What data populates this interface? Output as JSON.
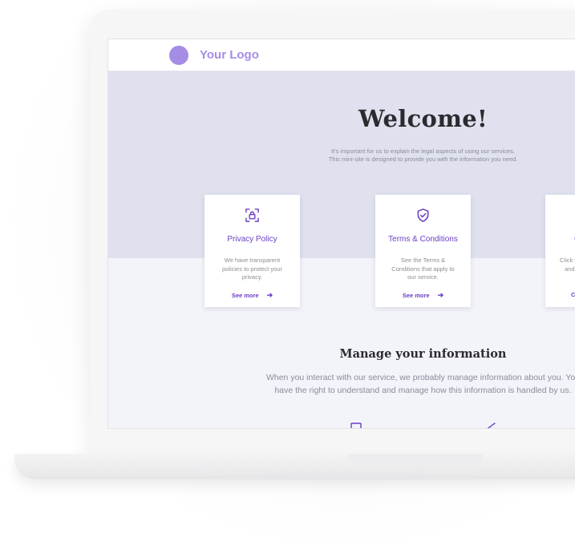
{
  "header": {
    "logo_text": "Your Logo"
  },
  "hero": {
    "title": "Welcome!",
    "subtitle_line1": "It's important for us to explain the legal aspects of using our services.",
    "subtitle_line2": "This mini-site is designed to provide you with the information you need."
  },
  "cards": [
    {
      "icon": "lock-frame-icon",
      "title": "Privacy Policy",
      "desc_line1": "We have transparent",
      "desc_line2": "policies to protect your",
      "desc_line3": "privacy.",
      "link": "See more"
    },
    {
      "icon": "shield-check-icon",
      "title": "Terms & Conditions",
      "desc_line1": "See the Terms &",
      "desc_line2": "Conditions that apply to",
      "desc_line3": "our service.",
      "link": "See more"
    },
    {
      "icon": "",
      "title": "C",
      "desc_line1": "Click t",
      "desc_line2": "and",
      "desc_line3": "",
      "link": "C"
    }
  ],
  "manage": {
    "title": "Manage your information",
    "text_line1": "When you interact with our service, we probably manage information about you. You",
    "text_line2": "have the right to understand and manage how this information is handled by us."
  },
  "colors": {
    "accent": "#6a3fc4",
    "logo": "#a58de6",
    "hero_bg": "#dfe2ee",
    "page_bg": "#f3f4fa"
  }
}
